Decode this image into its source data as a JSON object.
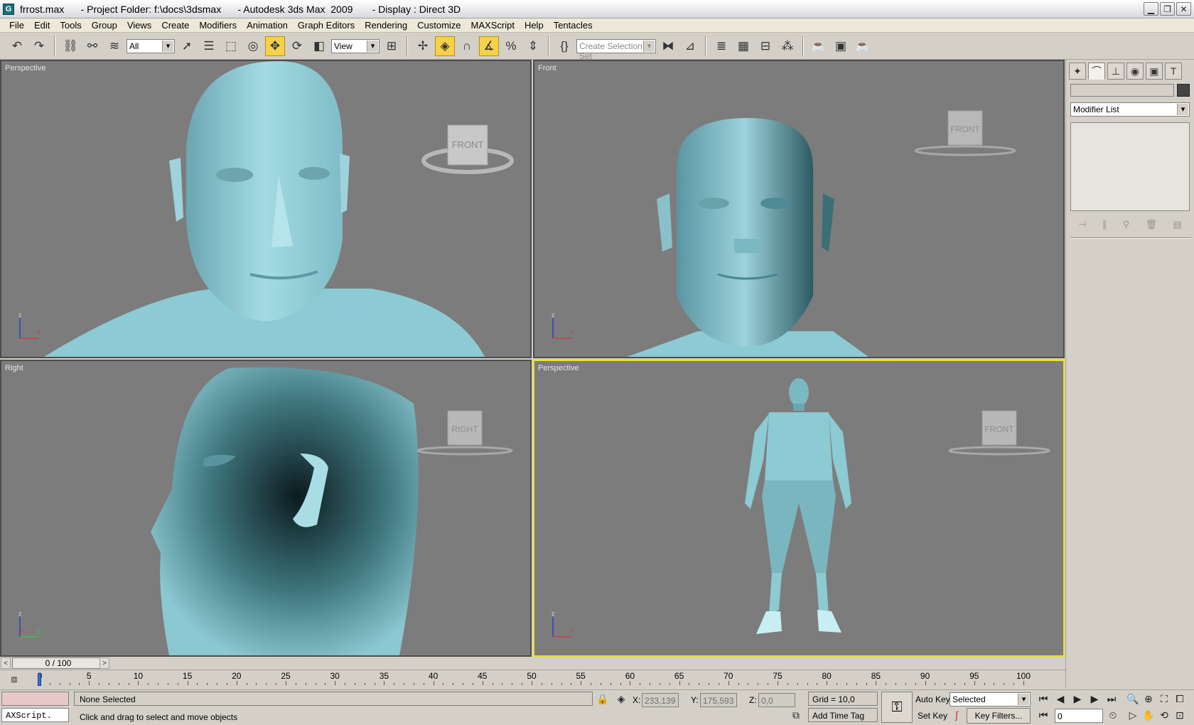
{
  "window": {
    "title": "frrost.max      - Project Folder: f:\\docs\\3dsmax      - Autodesk 3ds Max  2009       - Display : Direct 3D",
    "icon_letter": "G"
  },
  "menu": [
    "File",
    "Edit",
    "Tools",
    "Group",
    "Views",
    "Create",
    "Modifiers",
    "Animation",
    "Graph Editors",
    "Rendering",
    "Customize",
    "MAXScript",
    "Help",
    "Tentacles"
  ],
  "toolbar": {
    "filter_value": "All",
    "ref_coord_value": "View",
    "selection_set_placeholder": "Create Selection Set"
  },
  "viewports": {
    "top_left": {
      "label": "Perspective",
      "cube_face": "FRONT"
    },
    "top_right": {
      "label": "Front",
      "cube_face": "FRONT"
    },
    "bottom_left": {
      "label": "Right",
      "cube_face": "RIGHT"
    },
    "bottom_right": {
      "label": "Perspective",
      "cube_face": "FRONT"
    },
    "axis_labels": {
      "z": "z",
      "x": "x",
      "y": "y"
    }
  },
  "command_panel": {
    "modifier_list": "Modifier List"
  },
  "time_slider": {
    "value": "0 / 100",
    "left_arrow": "<",
    "right_arrow": ">"
  },
  "trackbar": {
    "labels": [
      "0",
      "5",
      "10",
      "15",
      "20",
      "25",
      "30",
      "35",
      "40",
      "45",
      "50",
      "55",
      "60",
      "65",
      "70",
      "75",
      "80",
      "85",
      "90",
      "95",
      "100"
    ]
  },
  "status": {
    "maxscript_label": "AXScript.",
    "selection_info": "None Selected",
    "prompt": "Click and drag to select and move objects",
    "x_label": "X:",
    "x_value": "233,139",
    "y_label": "Y:",
    "y_value": "175,593",
    "z_label": "Z:",
    "z_value": "0,0",
    "grid": "Grid = 10,0",
    "add_time_tag": "Add Time Tag",
    "auto_key": "Auto Key",
    "set_key": "Set Key",
    "key_mode_value": "Selected",
    "key_filters": "Key Filters...",
    "frame_value": "0"
  },
  "colors": {
    "accent_active_viewport": "#f0e020",
    "skin": "#8cc8d2",
    "viewport_bg": "#7c7c7c"
  }
}
